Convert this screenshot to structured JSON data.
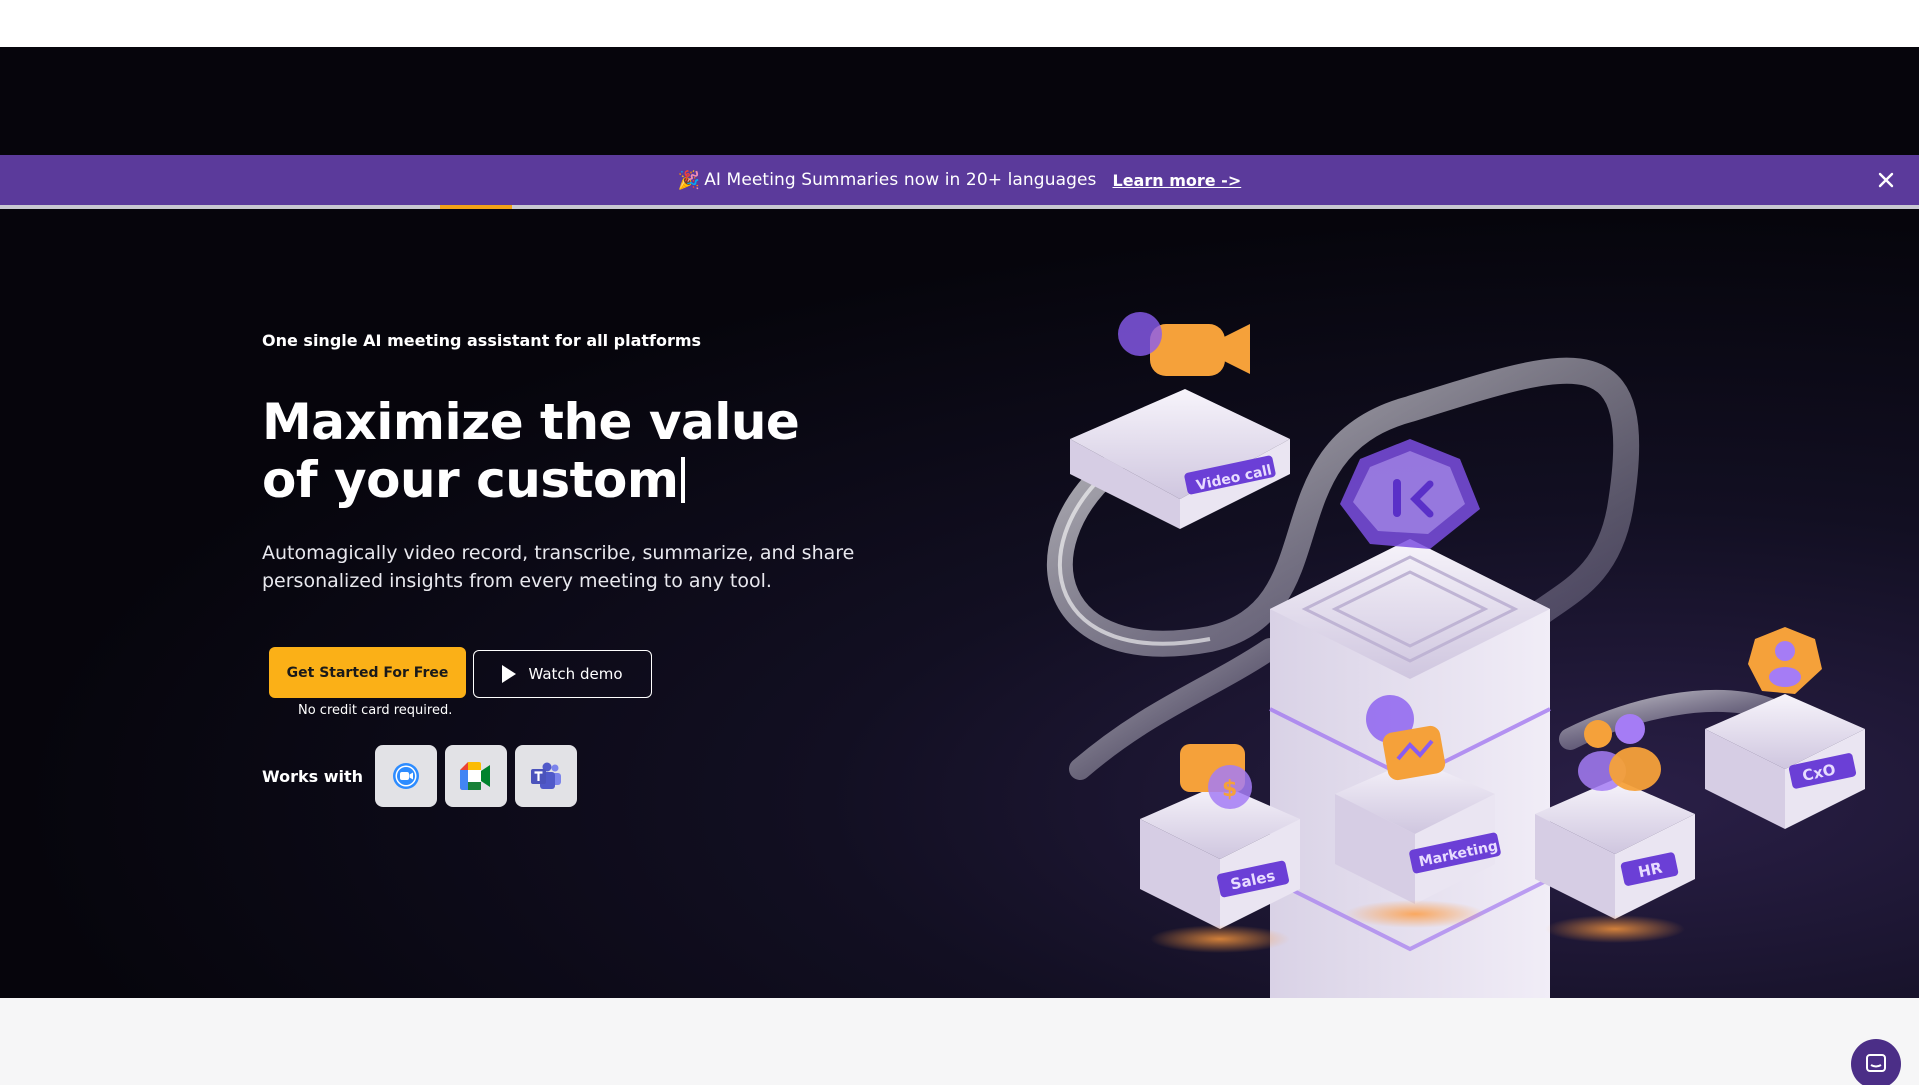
{
  "announcement": {
    "emoji": "🎉",
    "message": "AI Meeting Summaries now in 20+ languages",
    "link_label": "Learn more ->",
    "close_icon": "close-icon"
  },
  "hero": {
    "eyebrow": "One single AI meeting assistant for all platforms",
    "headline_line1": "Maximize the value",
    "headline_line2": "of your custom",
    "subtitle": "Automagically video record, transcribe, summarize, and share personalized insights from every meeting to any tool.",
    "cta_label": "Get Started For Free",
    "demo_label": "Watch demo",
    "no_card_note": "No credit card required.",
    "works_with_label": "Works with",
    "platforms": [
      "zoom-icon",
      "google-meet-icon",
      "microsoft-teams-icon"
    ]
  },
  "illustration": {
    "labels": [
      "Video call",
      "Sales",
      "Marketing",
      "HR",
      "CxO"
    ]
  },
  "colors": {
    "announcement_bg": "#5b3a9b",
    "hero_bg": "#06050c",
    "cta_bg": "#fbb017",
    "accent_purple": "#7b4fe0"
  }
}
